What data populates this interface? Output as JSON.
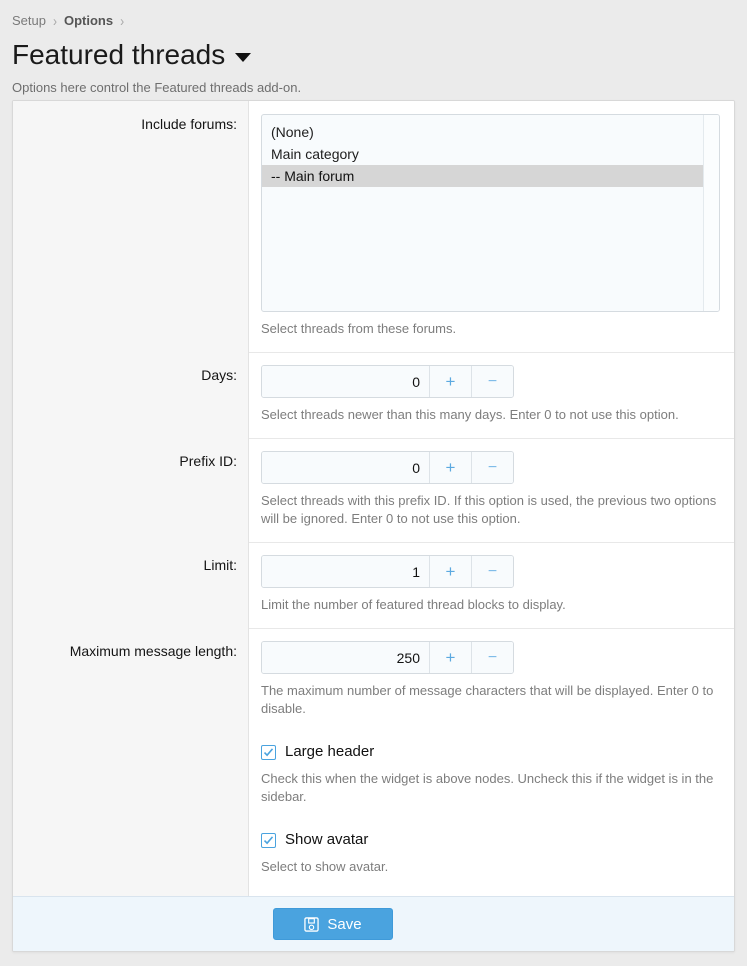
{
  "breadcrumb": {
    "items": [
      {
        "label": "Setup",
        "current": false
      },
      {
        "label": "Options",
        "current": true
      }
    ],
    "separator": "›"
  },
  "header": {
    "title": "Featured threads",
    "description": "Options here control the Featured threads add-on.",
    "caret_icon": "caret-down-icon"
  },
  "form": {
    "include_forums": {
      "label": "Include forums:",
      "help": "Select threads from these forums.",
      "options": [
        {
          "label": "(None)",
          "selected": false
        },
        {
          "label": "Main category",
          "selected": false
        },
        {
          "label": "-- Main forum",
          "selected": true
        }
      ]
    },
    "days": {
      "label": "Days:",
      "value": "0",
      "help": "Select threads newer than this many days. Enter 0 to not use this option.",
      "plus_label": "+",
      "minus_label": "−"
    },
    "prefix_id": {
      "label": "Prefix ID:",
      "value": "0",
      "help": "Select threads with this prefix ID. If this option is used, the previous two options will be ignored. Enter 0 to not use this option.",
      "plus_label": "+",
      "minus_label": "−"
    },
    "limit": {
      "label": "Limit:",
      "value": "1",
      "help": "Limit the number of featured thread blocks to display.",
      "plus_label": "+",
      "minus_label": "−"
    },
    "max_message_length": {
      "label": "Maximum message length:",
      "value": "250",
      "help": "The maximum number of message characters that will be displayed. Enter 0 to disable.",
      "plus_label": "+",
      "minus_label": "−"
    },
    "large_header": {
      "label": "Large header",
      "checked": true,
      "help": "Check this when the widget is above nodes. Uncheck this if the widget is in the sidebar."
    },
    "show_avatar": {
      "label": "Show avatar",
      "checked": true,
      "help": "Select to show avatar."
    }
  },
  "footer": {
    "save_label": "Save",
    "save_icon": "save-floppy-icon"
  },
  "colors": {
    "accent": "#4aa3df",
    "page_background": "#ebebeb",
    "card_background": "#ffffff",
    "gutter_background": "#f6f6f6",
    "footer_background": "#eef6fc",
    "selected_option_background": "#d6d6d6",
    "help_text": "#7d7d7d"
  }
}
